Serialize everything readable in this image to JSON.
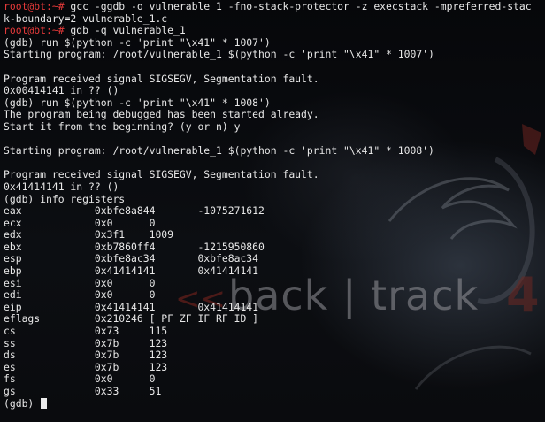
{
  "terminal": {
    "lines": [
      {
        "prompt": "root@bt:~#",
        "text": " gcc -ggdb -o vulnerable_1 -fno-stack-protector -z execstack -mpreferred-stac"
      },
      {
        "prompt": "",
        "text": "k-boundary=2 vulnerable_1.c"
      },
      {
        "prompt": "root@bt:~#",
        "text": " gdb -q vulnerable_1"
      },
      {
        "prompt": "",
        "text": "(gdb) run $(python -c 'print \"\\x41\" * 1007')"
      },
      {
        "prompt": "",
        "text": "Starting program: /root/vulnerable_1 $(python -c 'print \"\\x41\" * 1007')"
      },
      {
        "prompt": "",
        "text": ""
      },
      {
        "prompt": "",
        "text": "Program received signal SIGSEGV, Segmentation fault."
      },
      {
        "prompt": "",
        "text": "0x00414141 in ?? ()"
      },
      {
        "prompt": "",
        "text": "(gdb) run $(python -c 'print \"\\x41\" * 1008')"
      },
      {
        "prompt": "",
        "text": "The program being debugged has been started already."
      },
      {
        "prompt": "",
        "text": "Start it from the beginning? (y or n) y"
      },
      {
        "prompt": "",
        "text": ""
      },
      {
        "prompt": "",
        "text": "Starting program: /root/vulnerable_1 $(python -c 'print \"\\x41\" * 1008')"
      },
      {
        "prompt": "",
        "text": ""
      },
      {
        "prompt": "",
        "text": "Program received signal SIGSEGV, Segmentation fault."
      },
      {
        "prompt": "",
        "text": "0x41414141 in ?? ()"
      },
      {
        "prompt": "",
        "text": "(gdb) info registers"
      },
      {
        "prompt": "",
        "text": "eax            0xbfe8a844       -1075271612"
      },
      {
        "prompt": "",
        "text": "ecx            0x0      0"
      },
      {
        "prompt": "",
        "text": "edx            0x3f1    1009"
      },
      {
        "prompt": "",
        "text": "ebx            0xb7860ff4       -1215950860"
      },
      {
        "prompt": "",
        "text": "esp            0xbfe8ac34       0xbfe8ac34"
      },
      {
        "prompt": "",
        "text": "ebp            0x41414141       0x41414141"
      },
      {
        "prompt": "",
        "text": "esi            0x0      0"
      },
      {
        "prompt": "",
        "text": "edi            0x0      0"
      },
      {
        "prompt": "",
        "text": "eip            0x41414141       0x41414141"
      },
      {
        "prompt": "",
        "text": "eflags         0x210246 [ PF ZF IF RF ID ]"
      },
      {
        "prompt": "",
        "text": "cs             0x73     115"
      },
      {
        "prompt": "",
        "text": "ss             0x7b     123"
      },
      {
        "prompt": "",
        "text": "ds             0x7b     123"
      },
      {
        "prompt": "",
        "text": "es             0x7b     123"
      },
      {
        "prompt": "",
        "text": "fs             0x0      0"
      },
      {
        "prompt": "",
        "text": "gs             0x33     51"
      },
      {
        "prompt": "",
        "text": "(gdb) "
      }
    ]
  },
  "wallpaper": {
    "logo_text": "back | track",
    "logo_version": "4",
    "logo_arrow": "<<"
  },
  "colors": {
    "prompt": "#e63a3a",
    "text": "#e8e8e8",
    "background": "#0b0c0f"
  }
}
